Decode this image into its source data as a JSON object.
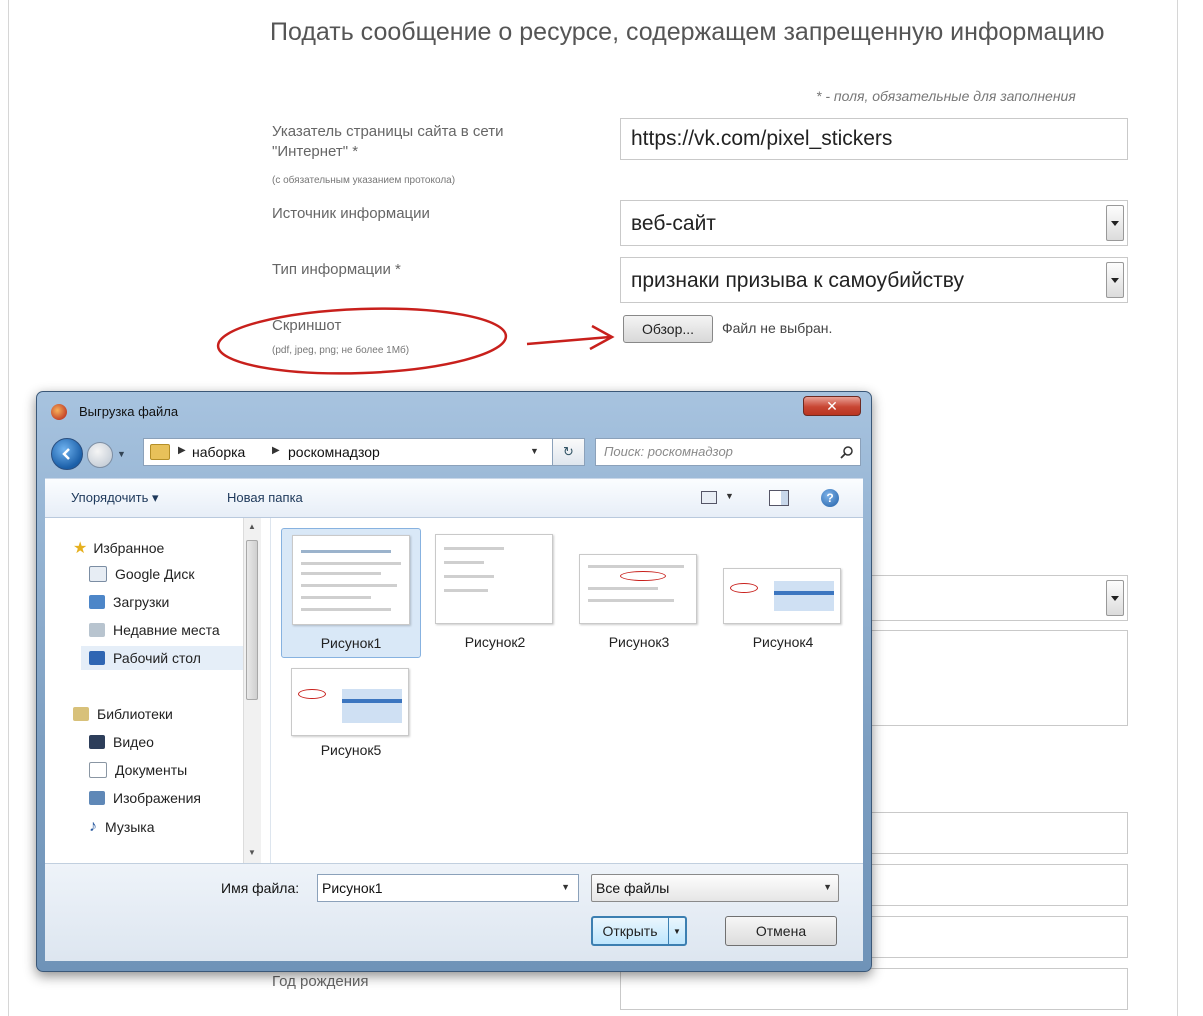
{
  "form": {
    "title": "Подать сообщение о ресурсе, содержащем запрещенную информацию",
    "required_note": "* - поля, обязательные для заполнения",
    "url_label": "Указатель страницы сайта в сети \"Интернет\" *",
    "url_hint": "(с обязательным указанием протокола)",
    "url_value": "https://vk.com/pixel_stickers",
    "source_label": "Источник информации",
    "source_value": "веб-сайт",
    "type_label": "Тип информации *",
    "type_value": "признаки призыва к самоубийству",
    "screenshot_label": "Скриншот",
    "screenshot_hint": "(pdf, jpeg, png; не более 1Мб)",
    "browse_label": "Обзор...",
    "no_file_text": "Файл не выбран.",
    "birth_year_label": "Год рождения"
  },
  "dialog": {
    "title": "Выгрузка файла",
    "close_label": "✕",
    "breadcrumb": [
      "наборка",
      "роскомнадзор"
    ],
    "search_placeholder": "Поиск: роскомнадзор",
    "organize_label": "Упорядочить ▾",
    "new_folder_label": "Новая папка",
    "nav": {
      "favorites": "Избранное",
      "google_drive": "Google Диск",
      "downloads": "Загрузки",
      "recent": "Недавние места",
      "desktop": "Рабочий стол",
      "libraries": "Библиотеки",
      "video": "Видео",
      "documents": "Документы",
      "images": "Изображения",
      "music": "Музыка"
    },
    "files": [
      "Рисунок1",
      "Рисунок2",
      "Рисунок3",
      "Рисунок4",
      "Рисунок5"
    ],
    "filename_label": "Имя файла:",
    "filename_value": "Рисунок1",
    "filter_value": "Все файлы",
    "open_label": "Открыть",
    "cancel_label": "Отмена"
  },
  "colors": {
    "annotation_red": "#c8201c",
    "selection": "#d9e8f7",
    "window_frame": "#7d9fc2"
  }
}
